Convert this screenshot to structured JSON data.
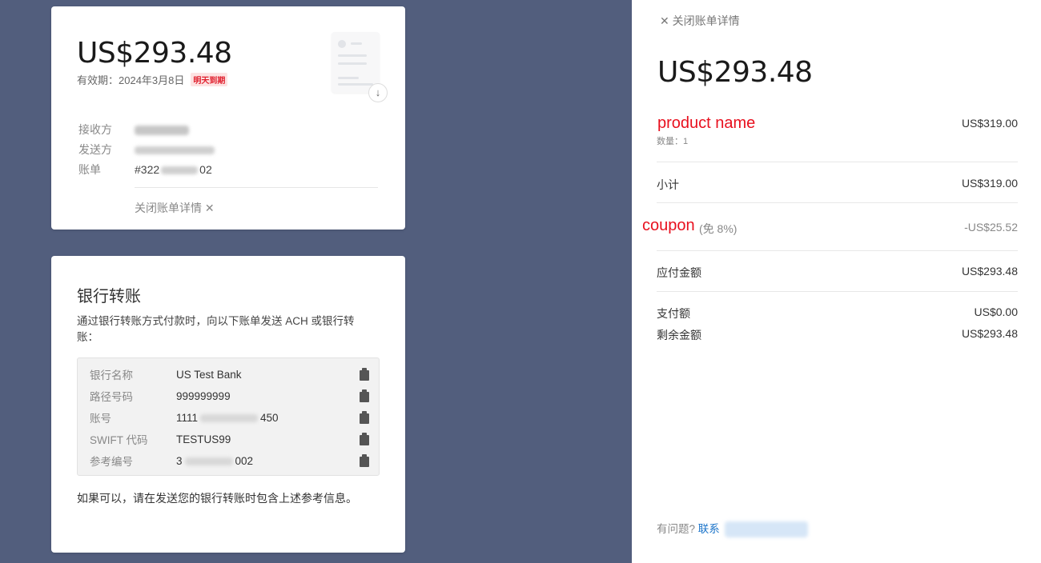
{
  "invoice": {
    "amount": "US$293.48",
    "due_label": "有效期：2024年3月8日",
    "due_badge": "明天到期",
    "recipient_label": "接收方",
    "recipient_value": "wang zijie",
    "sender_label": "发送方",
    "invoice_label": "账单",
    "invoice_value_prefix": "#322",
    "invoice_value_suffix": "02",
    "close_details": "关闭账单详情 ✕"
  },
  "bank": {
    "title": "银行转账",
    "description": "通过银行转账方式付款时，向以下账单发送 ACH 或银行转账：",
    "rows": [
      {
        "label": "银行名称",
        "value": "US Test Bank",
        "suffix": ""
      },
      {
        "label": "路径号码",
        "value": "999999999",
        "suffix": ""
      },
      {
        "label": "账号",
        "value": "1111",
        "suffix": "450"
      },
      {
        "label": "SWIFT 代码",
        "value": "TESTUS99",
        "suffix": ""
      },
      {
        "label": "参考编号",
        "value": "3",
        "suffix": "002"
      }
    ],
    "note": "如果可以，请在发送您的银行转账时包含上述参考信息。"
  },
  "details": {
    "close_label": "✕  关闭账单详情",
    "amount": "US$293.48",
    "product_annotation": "product name",
    "product_price": "US$319.00",
    "quantity": "数量：1",
    "subtotal_label": "小计",
    "subtotal_value": "US$319.00",
    "coupon_annotation": "coupon",
    "coupon_label": "(免 8%)",
    "coupon_value": "-US$25.52",
    "due_label": "应付金额",
    "due_value": "US$293.48",
    "paid_label": "支付额",
    "paid_value": "US$0.00",
    "remaining_label": "剩余金额",
    "remaining_value": "US$293.48",
    "help_prefix": "有问题?",
    "help_link": "联系"
  },
  "colors": {
    "background": "#525e7d",
    "badge_red": "#e0202e",
    "annotation_red": "#e8101e",
    "link_blue": "#1a73c9"
  }
}
